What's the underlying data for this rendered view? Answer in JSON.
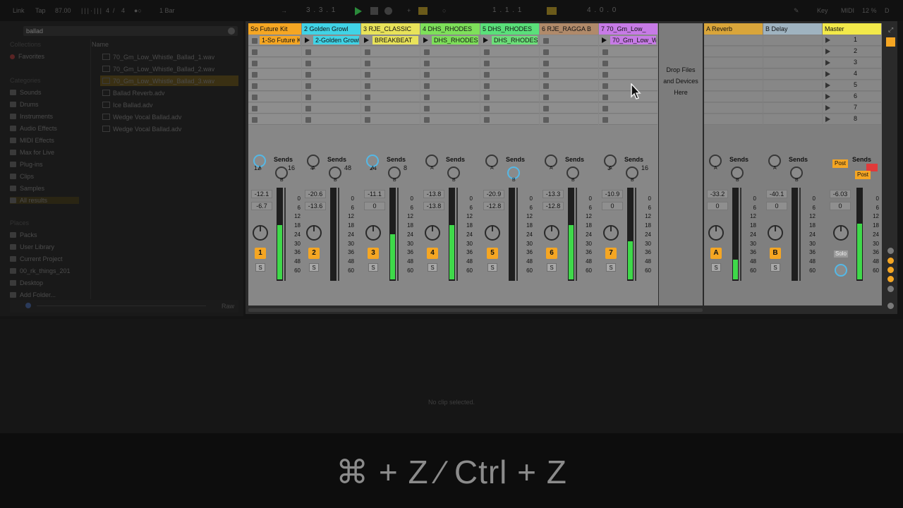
{
  "topbar": {
    "link": "Link",
    "tap": "Tap",
    "tempo": "87.00",
    "signature_num": "4",
    "signature_den": "4",
    "quantize": "1 Bar",
    "arrangement_position": "3 . 3 . 1",
    "loop_start": "1 . 1 . 1",
    "loop_length": "4 . 0 . 0",
    "key": "Key",
    "midi": "MIDI",
    "cpu": "12 %",
    "disk": "D"
  },
  "browser": {
    "search_value": "ballad",
    "collections_header": "Collections",
    "favorites": "Favorites",
    "categories_header": "Categories",
    "categories": [
      "Sounds",
      "Drums",
      "Instruments",
      "Audio Effects",
      "MIDI Effects",
      "Max for Live",
      "Plug-ins",
      "Clips",
      "Samples",
      "All results"
    ],
    "places_header": "Places",
    "places": [
      "Packs",
      "User Library",
      "Current Project",
      "00_rk_things_201",
      "Desktop",
      "Add Folder..."
    ],
    "name_header": "Name",
    "files": [
      "70_Gm_Low_Whistle_Ballad_1.wav",
      "70_Gm_Low_Whistle_Ballad_2.wav",
      "70_Gm_Low_Whistle_Ballad_3.wav",
      "Ballad Reverb.adv",
      "Ice Ballad.adv",
      "Wedge Vocal Ballad.adv",
      "Wedge Vocal Ballad.adv"
    ],
    "preview_raw": "Raw"
  },
  "tracks": [
    {
      "name": "So Future Kit",
      "color": "#f5a623",
      "clip": "1-So Future Kit",
      "clip_color": "#f5a623",
      "playing": false,
      "stat_a": "12",
      "stat_b": "16",
      "vol": "-12.1",
      "pan": "-6.7",
      "num": "1",
      "level": 0.6
    },
    {
      "name": "2 Golden Growl",
      "color": "#41d3e6",
      "clip": "2-Golden Growl",
      "clip_color": "#41d3e6",
      "playing": true,
      "stat_a": "4",
      "stat_b": "48",
      "vol": "-20.6",
      "pan": "-13.6",
      "num": "2",
      "level": 0.0
    },
    {
      "name": "3 RJE_CLASSIC",
      "color": "#e8e35a",
      "clip": "BREAKBEAT",
      "clip_color": "#e8e35a",
      "playing": true,
      "stat_a": "24",
      "stat_b": "8",
      "vol": "-11.1",
      "pan": "0",
      "num": "3",
      "level": 0.5
    },
    {
      "name": "4 DHS_RHODES",
      "color": "#7ee05a",
      "clip": "DHS_RHODES",
      "clip_color": "#7ee05a",
      "playing": true,
      "stat_a": "",
      "stat_b": "",
      "vol": "-13.8",
      "pan": "-13.8",
      "num": "4",
      "level": 0.6
    },
    {
      "name": "5 DHS_RHODES",
      "color": "#5ae07a",
      "clip": "DHS_RHODES",
      "clip_color": "#6de07a",
      "playing": true,
      "stat_a": "",
      "stat_b": "",
      "vol": "-20.9",
      "pan": "-12.8",
      "num": "5",
      "level": 0.0
    },
    {
      "name": "6 RJE_RAGGA B",
      "color": "#b08a6a",
      "clip": "",
      "clip_color": "",
      "playing": false,
      "stat_a": "",
      "stat_b": "",
      "vol": "-13.3",
      "pan": "-12.8",
      "num": "6",
      "level": 0.6
    },
    {
      "name": "7 70_Gm_Low_",
      "color": "#c77be6",
      "clip": "70_Gm_Low_W",
      "clip_color": "#c77be6",
      "playing": true,
      "stat_a": "3",
      "stat_b": "16",
      "vol": "-10.9",
      "pan": "0",
      "num": "7",
      "level": 0.42
    }
  ],
  "returns": [
    {
      "name": "A Reverb",
      "color": "#d9a53a",
      "vol": "-33.2",
      "pan": "0",
      "num": "A"
    },
    {
      "name": "B Delay",
      "color": "#9fb3c0",
      "vol": "-40.1",
      "pan": "0",
      "num": "B"
    }
  ],
  "master": {
    "name": "Master",
    "color": "#f2e94a",
    "vol": "-6.03",
    "pan": "0",
    "scenes": [
      "1",
      "2",
      "3",
      "4",
      "5",
      "6",
      "7",
      "8"
    ],
    "post": "Post",
    "solo": "Solo"
  },
  "drop_text": [
    "Drop Files",
    "and Devices",
    "Here"
  ],
  "sends_label": "Sends",
  "send_a": "A",
  "send_b": "B",
  "solo_label": "S",
  "meter_scale": [
    "0",
    "6",
    "12",
    "18",
    "24",
    "30",
    "36",
    "48",
    "60"
  ],
  "detail": {
    "message": "No clip selected."
  },
  "caption": {
    "shortcut": "⌘ + Z ∕ Ctrl + Z"
  }
}
